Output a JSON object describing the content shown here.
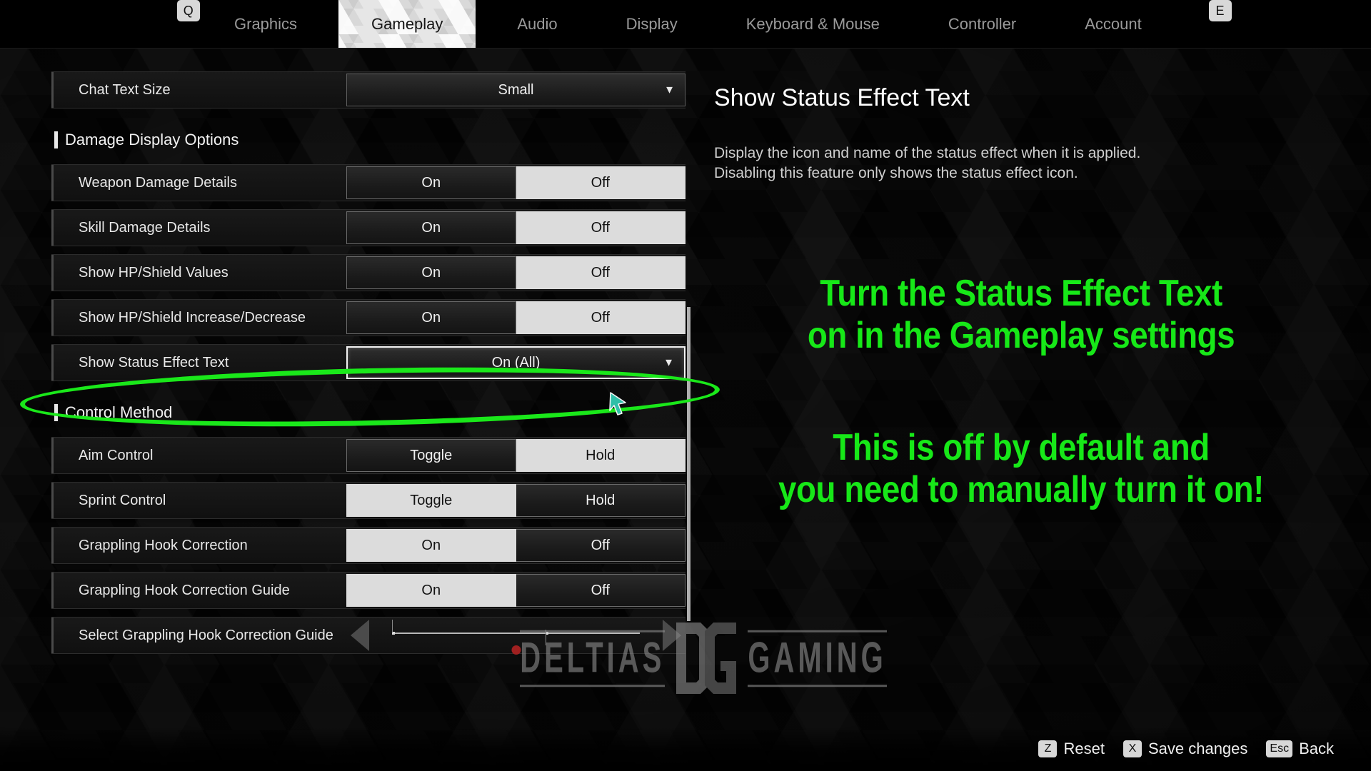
{
  "nav": {
    "left_key": "Q",
    "right_key": "E",
    "tabs": [
      {
        "label": "Graphics",
        "active": false
      },
      {
        "label": "Gameplay",
        "active": true
      },
      {
        "label": "Audio",
        "active": false
      },
      {
        "label": "Display",
        "active": false
      },
      {
        "label": "Keyboard & Mouse",
        "active": false
      },
      {
        "label": "Controller",
        "active": false
      },
      {
        "label": "Account",
        "active": false
      }
    ]
  },
  "settings": {
    "chat_text_size": {
      "label": "Chat Text Size",
      "value": "Small",
      "caret": "▼"
    },
    "section_damage": {
      "title": "Damage Display Options"
    },
    "rows_damage": [
      {
        "label": "Weapon Damage Details",
        "opt_a": "On",
        "opt_b": "Off",
        "selected": "Off"
      },
      {
        "label": "Skill Damage Details",
        "opt_a": "On",
        "opt_b": "Off",
        "selected": "Off"
      },
      {
        "label": "Show HP/Shield Values",
        "opt_a": "On",
        "opt_b": "Off",
        "selected": "Off"
      },
      {
        "label": "Show HP/Shield Increase/Decrease",
        "opt_a": "On",
        "opt_b": "Off",
        "selected": "Off"
      }
    ],
    "status_effect": {
      "label": "Show Status Effect Text",
      "value": "On (All)",
      "caret": "▼"
    },
    "section_control": {
      "title": "Control Method"
    },
    "rows_control": [
      {
        "label": "Aim Control",
        "opt_a": "Toggle",
        "opt_b": "Hold",
        "selected": "Hold"
      },
      {
        "label": "Sprint Control",
        "opt_a": "Toggle",
        "opt_b": "Hold",
        "selected": "Toggle"
      },
      {
        "label": "Grappling Hook Correction",
        "opt_a": "On",
        "opt_b": "Off",
        "selected": "On"
      },
      {
        "label": "Grappling Hook Correction Guide",
        "opt_a": "On",
        "opt_b": "Off",
        "selected": "On"
      }
    ],
    "selector_row": {
      "label": "Select Grappling Hook Correction Guide"
    }
  },
  "info": {
    "title": "Show Status Effect Text",
    "line1": "Display the icon and name of the status effect when it is applied.",
    "line2": "Disabling this feature only shows the status effect icon."
  },
  "annotations": {
    "color": "#17e818",
    "block1": "Turn the Status Effect Text\non in the Gameplay settings",
    "block2": "This is off by default and\nyou need to manually turn it on!"
  },
  "watermark": {
    "left": "DELTIAS",
    "right": "GAMING",
    "logo": "DG"
  },
  "footer": {
    "hints": [
      {
        "key": "Z",
        "label": "Reset"
      },
      {
        "key": "X",
        "label": "Save changes"
      },
      {
        "key": "Esc",
        "label": "Back"
      }
    ]
  }
}
